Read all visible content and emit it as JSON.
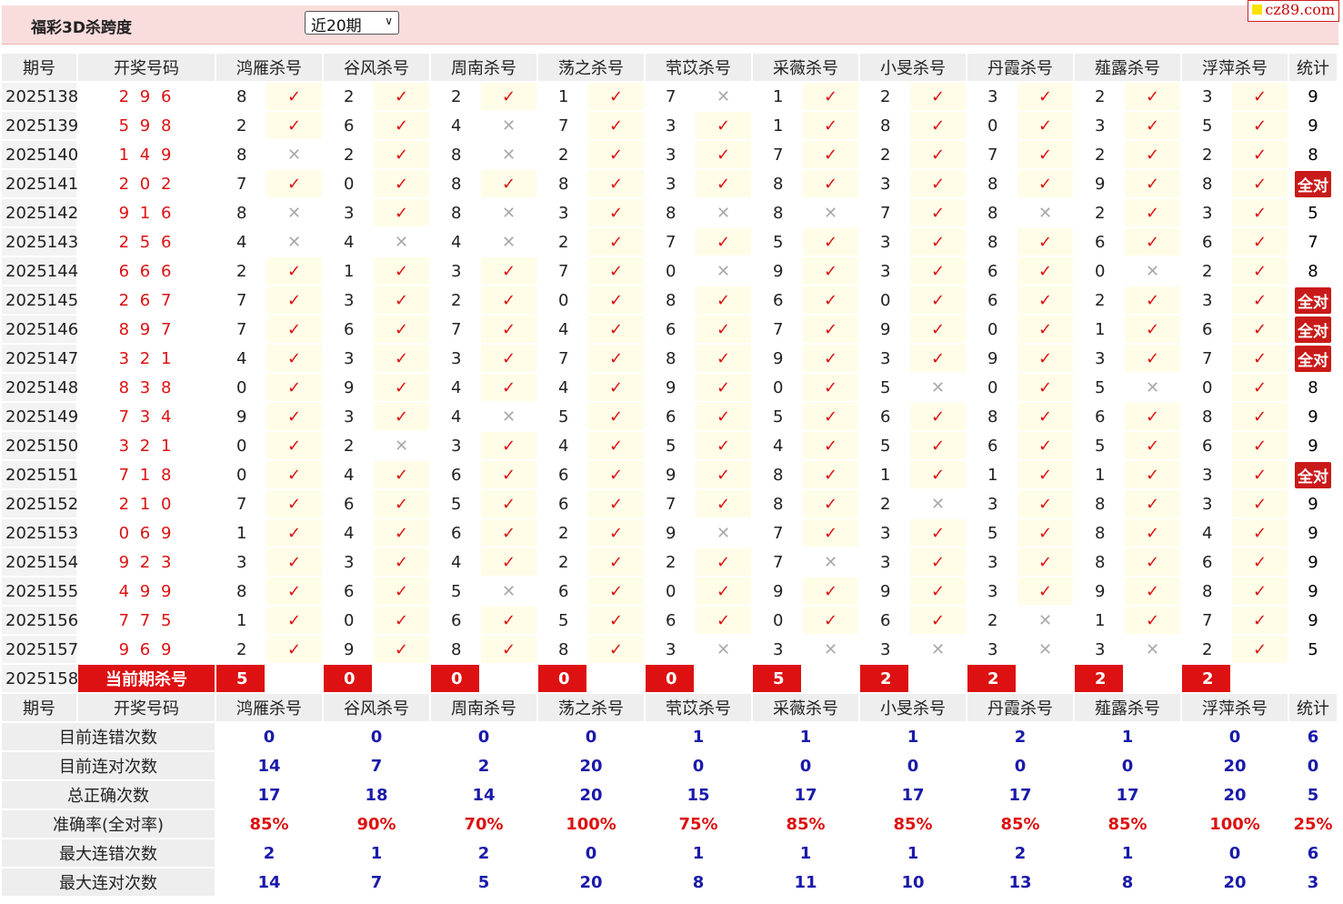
{
  "header": {
    "title": "福彩3D杀跨度",
    "period_select": "近20期",
    "logo": "cz89.com"
  },
  "columns": {
    "issue": "期号",
    "draw": "开奖号码",
    "experts": [
      "鸿雁杀号",
      "谷风杀号",
      "周南杀号",
      "荡之杀号",
      "茕苡杀号",
      "采薇杀号",
      "小旻杀号",
      "丹霞杀号",
      "薤露杀号",
      "浮萍杀号"
    ],
    "stats": "统计"
  },
  "rows": [
    {
      "issue": "2025138",
      "draw": "2 9 6",
      "kills": [
        8,
        2,
        2,
        1,
        7,
        1,
        2,
        3,
        2,
        3
      ],
      "results": [
        1,
        1,
        1,
        1,
        0,
        1,
        1,
        1,
        1,
        1
      ],
      "stat": "9"
    },
    {
      "issue": "2025139",
      "draw": "5 9 8",
      "kills": [
        2,
        6,
        4,
        7,
        3,
        1,
        8,
        0,
        3,
        5
      ],
      "results": [
        1,
        1,
        0,
        1,
        1,
        1,
        1,
        1,
        1,
        1
      ],
      "stat": "9"
    },
    {
      "issue": "2025140",
      "draw": "1 4 9",
      "kills": [
        8,
        2,
        8,
        2,
        3,
        7,
        2,
        7,
        2,
        2
      ],
      "results": [
        0,
        1,
        0,
        1,
        1,
        1,
        1,
        1,
        1,
        1
      ],
      "stat": "8"
    },
    {
      "issue": "2025141",
      "draw": "2 0 2",
      "kills": [
        7,
        0,
        8,
        8,
        3,
        8,
        3,
        8,
        9,
        8
      ],
      "results": [
        1,
        1,
        1,
        1,
        1,
        1,
        1,
        1,
        1,
        1
      ],
      "stat": "全对"
    },
    {
      "issue": "2025142",
      "draw": "9 1 6",
      "kills": [
        8,
        3,
        8,
        3,
        8,
        8,
        7,
        8,
        2,
        3
      ],
      "results": [
        0,
        1,
        0,
        1,
        0,
        0,
        1,
        0,
        1,
        1
      ],
      "stat": "5"
    },
    {
      "issue": "2025143",
      "draw": "2 5 6",
      "kills": [
        4,
        4,
        4,
        2,
        7,
        5,
        3,
        8,
        6,
        6
      ],
      "results": [
        0,
        0,
        0,
        1,
        1,
        1,
        1,
        1,
        1,
        1
      ],
      "stat": "7"
    },
    {
      "issue": "2025144",
      "draw": "6 6 6",
      "kills": [
        2,
        1,
        3,
        7,
        0,
        9,
        3,
        6,
        0,
        2
      ],
      "results": [
        1,
        1,
        1,
        1,
        0,
        1,
        1,
        1,
        0,
        1
      ],
      "stat": "8"
    },
    {
      "issue": "2025145",
      "draw": "2 6 7",
      "kills": [
        7,
        3,
        2,
        0,
        8,
        6,
        0,
        6,
        2,
        3
      ],
      "results": [
        1,
        1,
        1,
        1,
        1,
        1,
        1,
        1,
        1,
        1
      ],
      "stat": "全对"
    },
    {
      "issue": "2025146",
      "draw": "8 9 7",
      "kills": [
        7,
        6,
        7,
        4,
        6,
        7,
        9,
        0,
        1,
        6
      ],
      "results": [
        1,
        1,
        1,
        1,
        1,
        1,
        1,
        1,
        1,
        1
      ],
      "stat": "全对"
    },
    {
      "issue": "2025147",
      "draw": "3 2 1",
      "kills": [
        4,
        3,
        3,
        7,
        8,
        9,
        3,
        9,
        3,
        7
      ],
      "results": [
        1,
        1,
        1,
        1,
        1,
        1,
        1,
        1,
        1,
        1
      ],
      "stat": "全对"
    },
    {
      "issue": "2025148",
      "draw": "8 3 8",
      "kills": [
        0,
        9,
        4,
        4,
        9,
        0,
        5,
        0,
        5,
        0
      ],
      "results": [
        1,
        1,
        1,
        1,
        1,
        1,
        0,
        1,
        0,
        1
      ],
      "stat": "8"
    },
    {
      "issue": "2025149",
      "draw": "7 3 4",
      "kills": [
        9,
        3,
        4,
        5,
        6,
        5,
        6,
        8,
        6,
        8
      ],
      "results": [
        1,
        1,
        0,
        1,
        1,
        1,
        1,
        1,
        1,
        1
      ],
      "stat": "9"
    },
    {
      "issue": "2025150",
      "draw": "3 2 1",
      "kills": [
        0,
        2,
        3,
        4,
        5,
        4,
        5,
        6,
        5,
        6
      ],
      "results": [
        1,
        0,
        1,
        1,
        1,
        1,
        1,
        1,
        1,
        1
      ],
      "stat": "9"
    },
    {
      "issue": "2025151",
      "draw": "7 1 8",
      "kills": [
        0,
        4,
        6,
        6,
        9,
        8,
        1,
        1,
        1,
        3
      ],
      "results": [
        1,
        1,
        1,
        1,
        1,
        1,
        1,
        1,
        1,
        1
      ],
      "stat": "全对"
    },
    {
      "issue": "2025152",
      "draw": "2 1 0",
      "kills": [
        7,
        6,
        5,
        6,
        7,
        8,
        2,
        3,
        8,
        3
      ],
      "results": [
        1,
        1,
        1,
        1,
        1,
        1,
        0,
        1,
        1,
        1
      ],
      "stat": "9"
    },
    {
      "issue": "2025153",
      "draw": "0 6 9",
      "kills": [
        1,
        4,
        6,
        2,
        9,
        7,
        3,
        5,
        8,
        4
      ],
      "results": [
        1,
        1,
        1,
        1,
        0,
        1,
        1,
        1,
        1,
        1
      ],
      "stat": "9"
    },
    {
      "issue": "2025154",
      "draw": "9 2 3",
      "kills": [
        3,
        3,
        4,
        2,
        2,
        7,
        3,
        3,
        8,
        6
      ],
      "results": [
        1,
        1,
        1,
        1,
        1,
        0,
        1,
        1,
        1,
        1
      ],
      "stat": "9"
    },
    {
      "issue": "2025155",
      "draw": "4 9 9",
      "kills": [
        8,
        6,
        5,
        6,
        0,
        9,
        9,
        3,
        9,
        8
      ],
      "results": [
        1,
        1,
        0,
        1,
        1,
        1,
        1,
        1,
        1,
        1
      ],
      "stat": "9"
    },
    {
      "issue": "2025156",
      "draw": "7 7 5",
      "kills": [
        1,
        0,
        6,
        5,
        6,
        0,
        6,
        2,
        1,
        7
      ],
      "results": [
        1,
        1,
        1,
        1,
        1,
        1,
        1,
        0,
        1,
        1
      ],
      "stat": "9"
    },
    {
      "issue": "2025157",
      "draw": "9 6 9",
      "kills": [
        2,
        9,
        8,
        8,
        3,
        3,
        3,
        3,
        3,
        2
      ],
      "results": [
        1,
        1,
        1,
        1,
        0,
        0,
        0,
        0,
        0,
        1
      ],
      "stat": "5"
    }
  ],
  "current": {
    "issue": "2025158",
    "label": "当前期杀号",
    "kills": [
      5,
      0,
      0,
      0,
      0,
      5,
      2,
      2,
      2,
      2
    ]
  },
  "marks": {
    "right": "✓",
    "wrong": "✕"
  },
  "summary": [
    {
      "label": "目前连错次数",
      "values": [
        "0",
        "0",
        "0",
        "0",
        "1",
        "1",
        "1",
        "2",
        "1",
        "0",
        "6"
      ],
      "style": "stat"
    },
    {
      "label": "目前连对次数",
      "values": [
        "14",
        "7",
        "2",
        "20",
        "0",
        "0",
        "0",
        "0",
        "0",
        "20",
        "0"
      ],
      "style": "stat"
    },
    {
      "label": "总正确次数",
      "values": [
        "17",
        "18",
        "14",
        "20",
        "15",
        "17",
        "17",
        "17",
        "17",
        "20",
        "5"
      ],
      "style": "stat"
    },
    {
      "label": "准确率(全对率)",
      "values": [
        "85%",
        "90%",
        "70%",
        "100%",
        "75%",
        "85%",
        "85%",
        "85%",
        "85%",
        "100%",
        "25%"
      ],
      "style": "rate"
    },
    {
      "label": "最大连错次数",
      "values": [
        "2",
        "1",
        "2",
        "0",
        "1",
        "1",
        "1",
        "2",
        "1",
        "0",
        "6"
      ],
      "style": "stat"
    },
    {
      "label": "最大连对次数",
      "values": [
        "14",
        "7",
        "5",
        "20",
        "8",
        "11",
        "10",
        "13",
        "8",
        "20",
        "3"
      ],
      "style": "stat"
    }
  ]
}
